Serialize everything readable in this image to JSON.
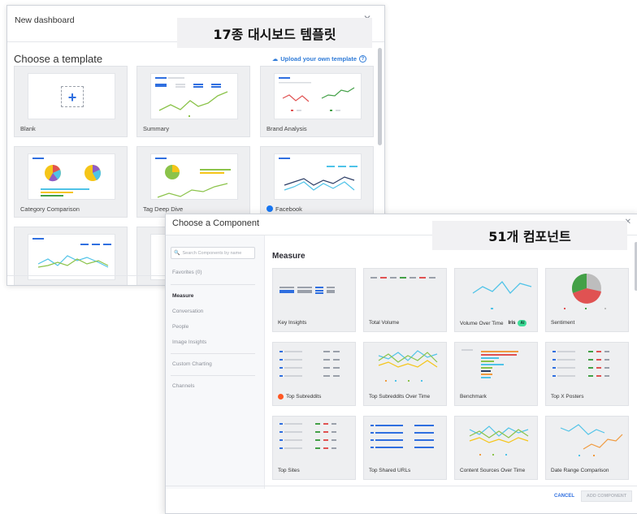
{
  "banners": {
    "templates": "17종 대시보드 템플릿",
    "components": "51개 컴포넌트"
  },
  "dashboard_window": {
    "title": "New dashboard",
    "heading": "Choose a template",
    "upload_link": "Upload your own template",
    "templates": [
      {
        "label": "Blank"
      },
      {
        "label": "Summary"
      },
      {
        "label": "Brand Analysis"
      },
      {
        "label": "Category Comparison"
      },
      {
        "label": "Tag Deep Dive"
      },
      {
        "label": "Facebook"
      }
    ]
  },
  "component_window": {
    "title": "Choose a Component",
    "search_placeholder": "Search Components by name",
    "sidebar": [
      {
        "label": "Favorites (0)"
      },
      {
        "label": "Measure"
      },
      {
        "label": "Conversation"
      },
      {
        "label": "People"
      },
      {
        "label": "Image Insights"
      },
      {
        "label": "Custom Charting"
      },
      {
        "label": "Channels"
      }
    ],
    "section_heading": "Measure",
    "components": [
      {
        "label": "Key Insights"
      },
      {
        "label": "Total Volume"
      },
      {
        "label": "Volume Over Time",
        "badge_brand": "Iris",
        "badge": "AI"
      },
      {
        "label": "Sentiment"
      },
      {
        "label": "Top Subreddits"
      },
      {
        "label": "Top Subreddits Over Time"
      },
      {
        "label": "Benchmark"
      },
      {
        "label": "Top X Posters"
      },
      {
        "label": "Top Sites"
      },
      {
        "label": "Top Shared URLs"
      },
      {
        "label": "Content Sources Over Time"
      },
      {
        "label": "Date Range Comparison"
      }
    ],
    "cancel_label": "CANCEL",
    "add_label": "ADD COMPONENT"
  },
  "colors": {
    "accent": "#2f6fe0",
    "link": "#2f7bd8",
    "chart_green": "#8bc34a",
    "chart_cyan": "#4fc3e8",
    "chart_red": "#e05252",
    "chart_navy": "#2d3e66",
    "chart_orange": "#f09a3e",
    "sentiment_positive": "#43a047",
    "sentiment_negative": "#e05252",
    "sentiment_neutral": "#bdbdbd"
  }
}
